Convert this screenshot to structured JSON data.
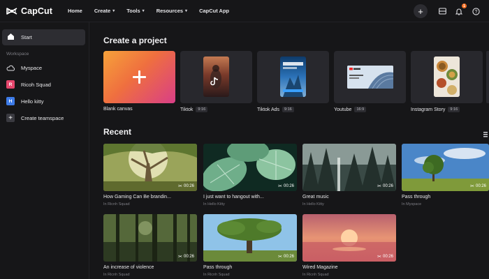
{
  "app": {
    "logo_text": "CapCut"
  },
  "nav": {
    "home": "Home",
    "create": "Create",
    "tools": "Tools",
    "resources": "Resources",
    "app": "CapCut App"
  },
  "top_actions": {
    "notification_count": "1"
  },
  "sidebar": {
    "start": "Start",
    "workspace_title": "Workspace",
    "items": [
      {
        "label": "Myspace",
        "icon": "cloud-icon"
      },
      {
        "label": "Ricoh Squad",
        "initial": "R",
        "color": "#e5466c"
      },
      {
        "label": "Hello kitty",
        "initial": "H",
        "color": "#3d7be8"
      },
      {
        "label": "Create teamspace",
        "icon": "plus-icon"
      }
    ]
  },
  "create_section": {
    "title": "Create a project",
    "templates": [
      {
        "label": "Blank canvas",
        "ratio": ""
      },
      {
        "label": "Tiktok",
        "ratio": "9:16"
      },
      {
        "label": "Tiktok Ads",
        "ratio": "9:16"
      },
      {
        "label": "Youtube",
        "ratio": "16:9"
      },
      {
        "label": "Instagram Story",
        "ratio": "9:16"
      }
    ]
  },
  "recent_section": {
    "title": "Recent",
    "items": [
      {
        "title": "How Gaming Can Be brandin...",
        "space": "In Ricnh Squad",
        "duration": "00:26"
      },
      {
        "title": "I just want to hangout with...",
        "space": "In Hello Kitty",
        "duration": "00:26"
      },
      {
        "title": "Great music",
        "space": "In Hello Kitty",
        "duration": "00:26"
      },
      {
        "title": "Pass through",
        "space": "In Myspace",
        "duration": "00:26"
      },
      {
        "title": "An increase of violence",
        "space": "In Ricnh Squad",
        "duration": "00:26"
      },
      {
        "title": "Pass through",
        "space": "In Ricnh Squad",
        "duration": "00:26"
      },
      {
        "title": "Wired Magazine",
        "space": "In Ricnh Squad",
        "duration": "00:26"
      }
    ]
  }
}
